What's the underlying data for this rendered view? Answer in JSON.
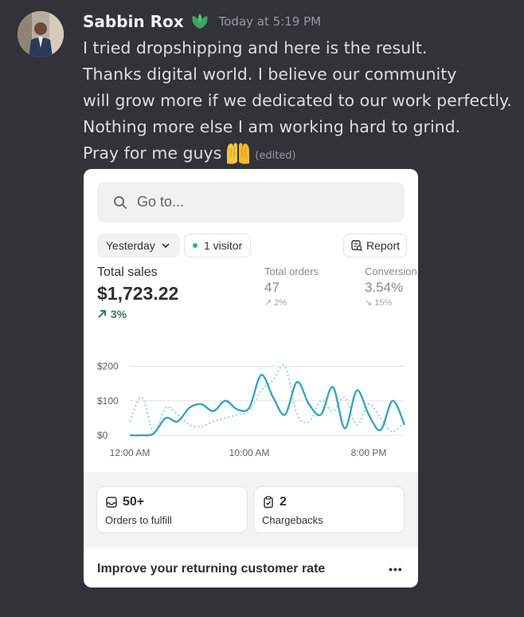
{
  "message": {
    "username": "Sabbin Rox",
    "timestamp": "Today at 5:19 PM",
    "lines": [
      "I tried dropshipping  and here is  the result.",
      "Thanks digital world. I believe our community",
      "will grow more if we dedicated to our work perfectly.",
      "Nothing more else I am working hard to grind.",
      "Pray for me guys"
    ],
    "edited_label": "(edited)",
    "role_icon": "leaf-badge-icon",
    "emoji": "palms-up-together-emoji"
  },
  "screenshot": {
    "search_placeholder": "Go to...",
    "date_filter": "Yesterday",
    "visitors": "1 visitor",
    "report_label": "Report",
    "metrics": {
      "total_sales": {
        "label": "Total sales",
        "value": "$1,723.22",
        "change": "3%"
      },
      "total_orders": {
        "label": "Total orders",
        "value": "47",
        "change": "2%"
      },
      "conversion": {
        "label": "Conversion",
        "value": "3.54%",
        "change": "15%"
      }
    },
    "tiles": [
      {
        "value": "50+",
        "label": "Orders to fulfill"
      },
      {
        "value": "2",
        "label": "Chargebacks"
      }
    ],
    "footer_title": "Improve your returning customer rate",
    "more_label": "•••",
    "colors": {
      "current_line": "#3aa5be",
      "previous_line": "#9fcfd9",
      "positive": "#29845a"
    }
  },
  "chart_data": {
    "type": "line",
    "x": [
      "12:00 AM",
      "1:00 AM",
      "2:00 AM",
      "3:00 AM",
      "4:00 AM",
      "5:00 AM",
      "6:00 AM",
      "7:00 AM",
      "8:00 AM",
      "9:00 AM",
      "10:00 AM",
      "11:00 AM",
      "12:00 PM",
      "1:00 PM",
      "2:00 PM",
      "3:00 PM",
      "4:00 PM",
      "5:00 PM",
      "6:00 PM",
      "7:00 PM",
      "8:00 PM",
      "9:00 PM",
      "10:00 PM",
      "11:00 PM"
    ],
    "series": [
      {
        "values": [
          0,
          0,
          5,
          50,
          40,
          80,
          90,
          70,
          100,
          75,
          80,
          175,
          110,
          60,
          155,
          90,
          60,
          140,
          20,
          130,
          60,
          15,
          100,
          30
        ]
      },
      {
        "values": [
          40,
          110,
          10,
          80,
          60,
          30,
          25,
          40,
          50,
          60,
          70,
          130,
          160,
          200,
          60,
          40,
          100,
          70,
          110,
          30,
          90,
          50,
          10,
          40
        ]
      }
    ],
    "yticks": [
      "$0",
      "$100",
      "$200"
    ],
    "xticks": [
      "12:00 AM",
      "10:00 AM",
      "8:00 PM"
    ],
    "ylim": [
      0,
      250
    ],
    "grid": true
  }
}
